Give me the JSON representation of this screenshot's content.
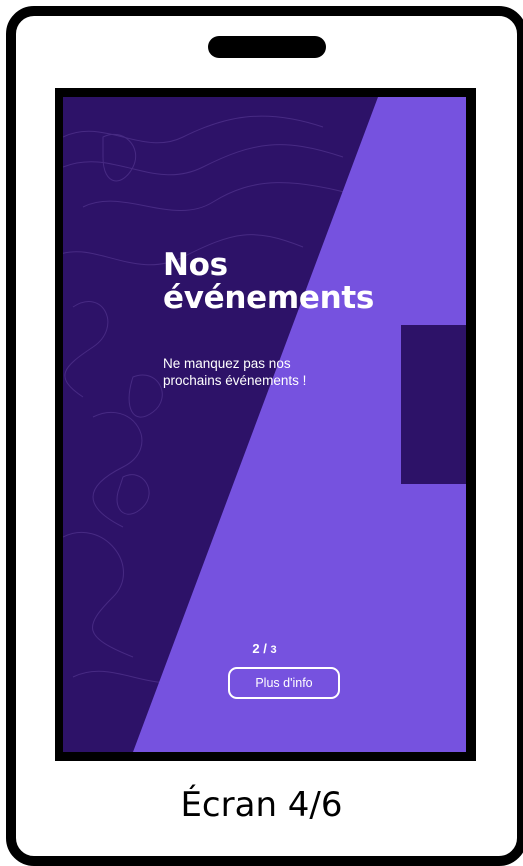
{
  "app": {
    "title_line1": "Nos",
    "title_line2": "événements",
    "subtitle_line1": "Ne manquez pas nos",
    "subtitle_line2": "prochains événements !",
    "pager": {
      "current": "2",
      "separator": " / ",
      "total": "3"
    },
    "info_button_label": "Plus d'info"
  },
  "caption": "Écran 4/6",
  "colors": {
    "background_dark": "#2d1268",
    "accent_purple": "#7652df",
    "contour_lines": "#4a2d86",
    "frame": "#000000",
    "text": "#ffffff"
  },
  "icons": {
    "speaker": "speaker-slot"
  }
}
